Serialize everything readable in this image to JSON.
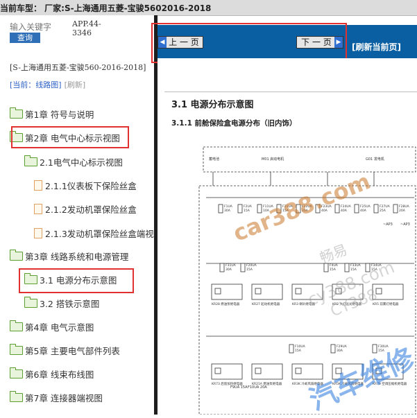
{
  "header": {
    "title": "当前车型：  厂家:S-上海通用五菱-宝骏5602016-2018"
  },
  "sidebar": {
    "search_label": "输入关键字",
    "search_button": "查询",
    "app_code": "APP.44-3346",
    "model": "[S-上海通用五菱-宝骏560-2016-2018]",
    "current_label": "[当前：线路图]",
    "refresh_label": "[刷新]",
    "tree": [
      "第1章 符号与说明",
      "第2章 电气中心标示视图",
      "2.1电气中心标示视图",
      "2.1.1仪表板下保险丝盒",
      "2.1.2发动机罩保险丝盒",
      "2.1.3发动机罩保险丝盒端视",
      "第3章 线路系统和电源管理",
      "3.1 电源分布示意图",
      "3.2 搭铁示意图",
      "第4章 电气示意图",
      "第5章 主要电气部件列表",
      "第6章 线束布线图",
      "第7章 连接器端视图"
    ]
  },
  "nav": {
    "prev_label": "上 一 页",
    "next_label": "下 一 页",
    "refresh_page": "[刷新当前页]"
  },
  "doc": {
    "section_title": "3.1 电源分布示意图",
    "subsection_title": "3.1.1 前舱保险盒电源分布（旧内饰）",
    "fuses_row1": [
      "F1UA 30A",
      "F2UA 15A",
      "F11UA 10A",
      "F21UA 15A",
      "F22UA 20A",
      "F23UA 40A",
      "F24UA 40A",
      "F25UA 40A",
      "F27UA 25A",
      "F28UA 20A"
    ],
    "fuses_row2": [
      "F31UA 30A",
      "F20UA 15A",
      "F4UA 15A",
      "F33UA 15A",
      "F34UA 15A"
    ],
    "fuses_row3": [
      "F10UA 15A",
      "F29UA 30A",
      "F30UA 15A"
    ],
    "top_labels": [
      "蓄电池",
      "M01 启动电机",
      "G01 发电机"
    ],
    "relays": [
      "KR28 燃油泵继电器",
      "KR27 起动机继电器",
      "KR3 喇叭继电器",
      "KR2 大灯远光继电器",
      "KR5 前雾灯继电器"
    ],
    "relays_low": [
      "KR73 后窗加热继电器",
      "KR21A 燃油泵继电器",
      "KR3K 冷却风扇继电器",
      "KR5K 冷却风扇继电器",
      "KR79 空调压缩机继电器"
    ],
    "small_labels": [
      "~AP3",
      "~AP3",
      "F9UA 15A",
      "F10UA 20A"
    ],
    "watermarks": [
      "car388.com",
      "畅易",
      "cy388.com",
      "CY388",
      "汽车维修"
    ]
  }
}
